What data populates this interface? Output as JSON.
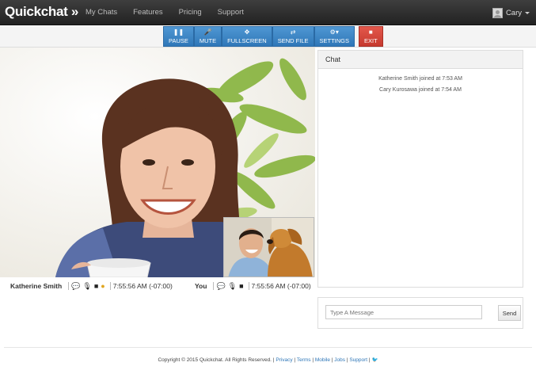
{
  "brand": "Quickchat »",
  "nav": [
    "My Chats",
    "Features",
    "Pricing",
    "Support"
  ],
  "user": {
    "name": "Cary"
  },
  "toolbar": [
    {
      "icon": "❚❚",
      "label": "PAUSE"
    },
    {
      "icon": "🎤",
      "label": "MUTE"
    },
    {
      "icon": "✥",
      "label": "FULLSCREEN"
    },
    {
      "icon": "⇄",
      "label": "SEND FILE"
    },
    {
      "icon": "⚙▾",
      "label": "SETTINGS"
    }
  ],
  "exit": {
    "icon": "■",
    "label": "EXIT"
  },
  "remote": {
    "name": "Katherine Smith",
    "time": "7:55:56 AM (-07:00)"
  },
  "local": {
    "name": "You",
    "time": "7:55:56 AM (-07:00)"
  },
  "chat": {
    "title": "Chat",
    "messages": [
      "Katherine Smith joined at 7:53 AM",
      "Cary Kurosawa joined at 7:54 AM"
    ],
    "placeholder": "Type A Message",
    "send": "Send"
  },
  "footer": {
    "copyright": "Copyright © 2015 Quickchat. All Rights Reserved. |",
    "links": [
      "Privacy",
      "Terms",
      "Mobile",
      "Jobs",
      "Support"
    ]
  }
}
